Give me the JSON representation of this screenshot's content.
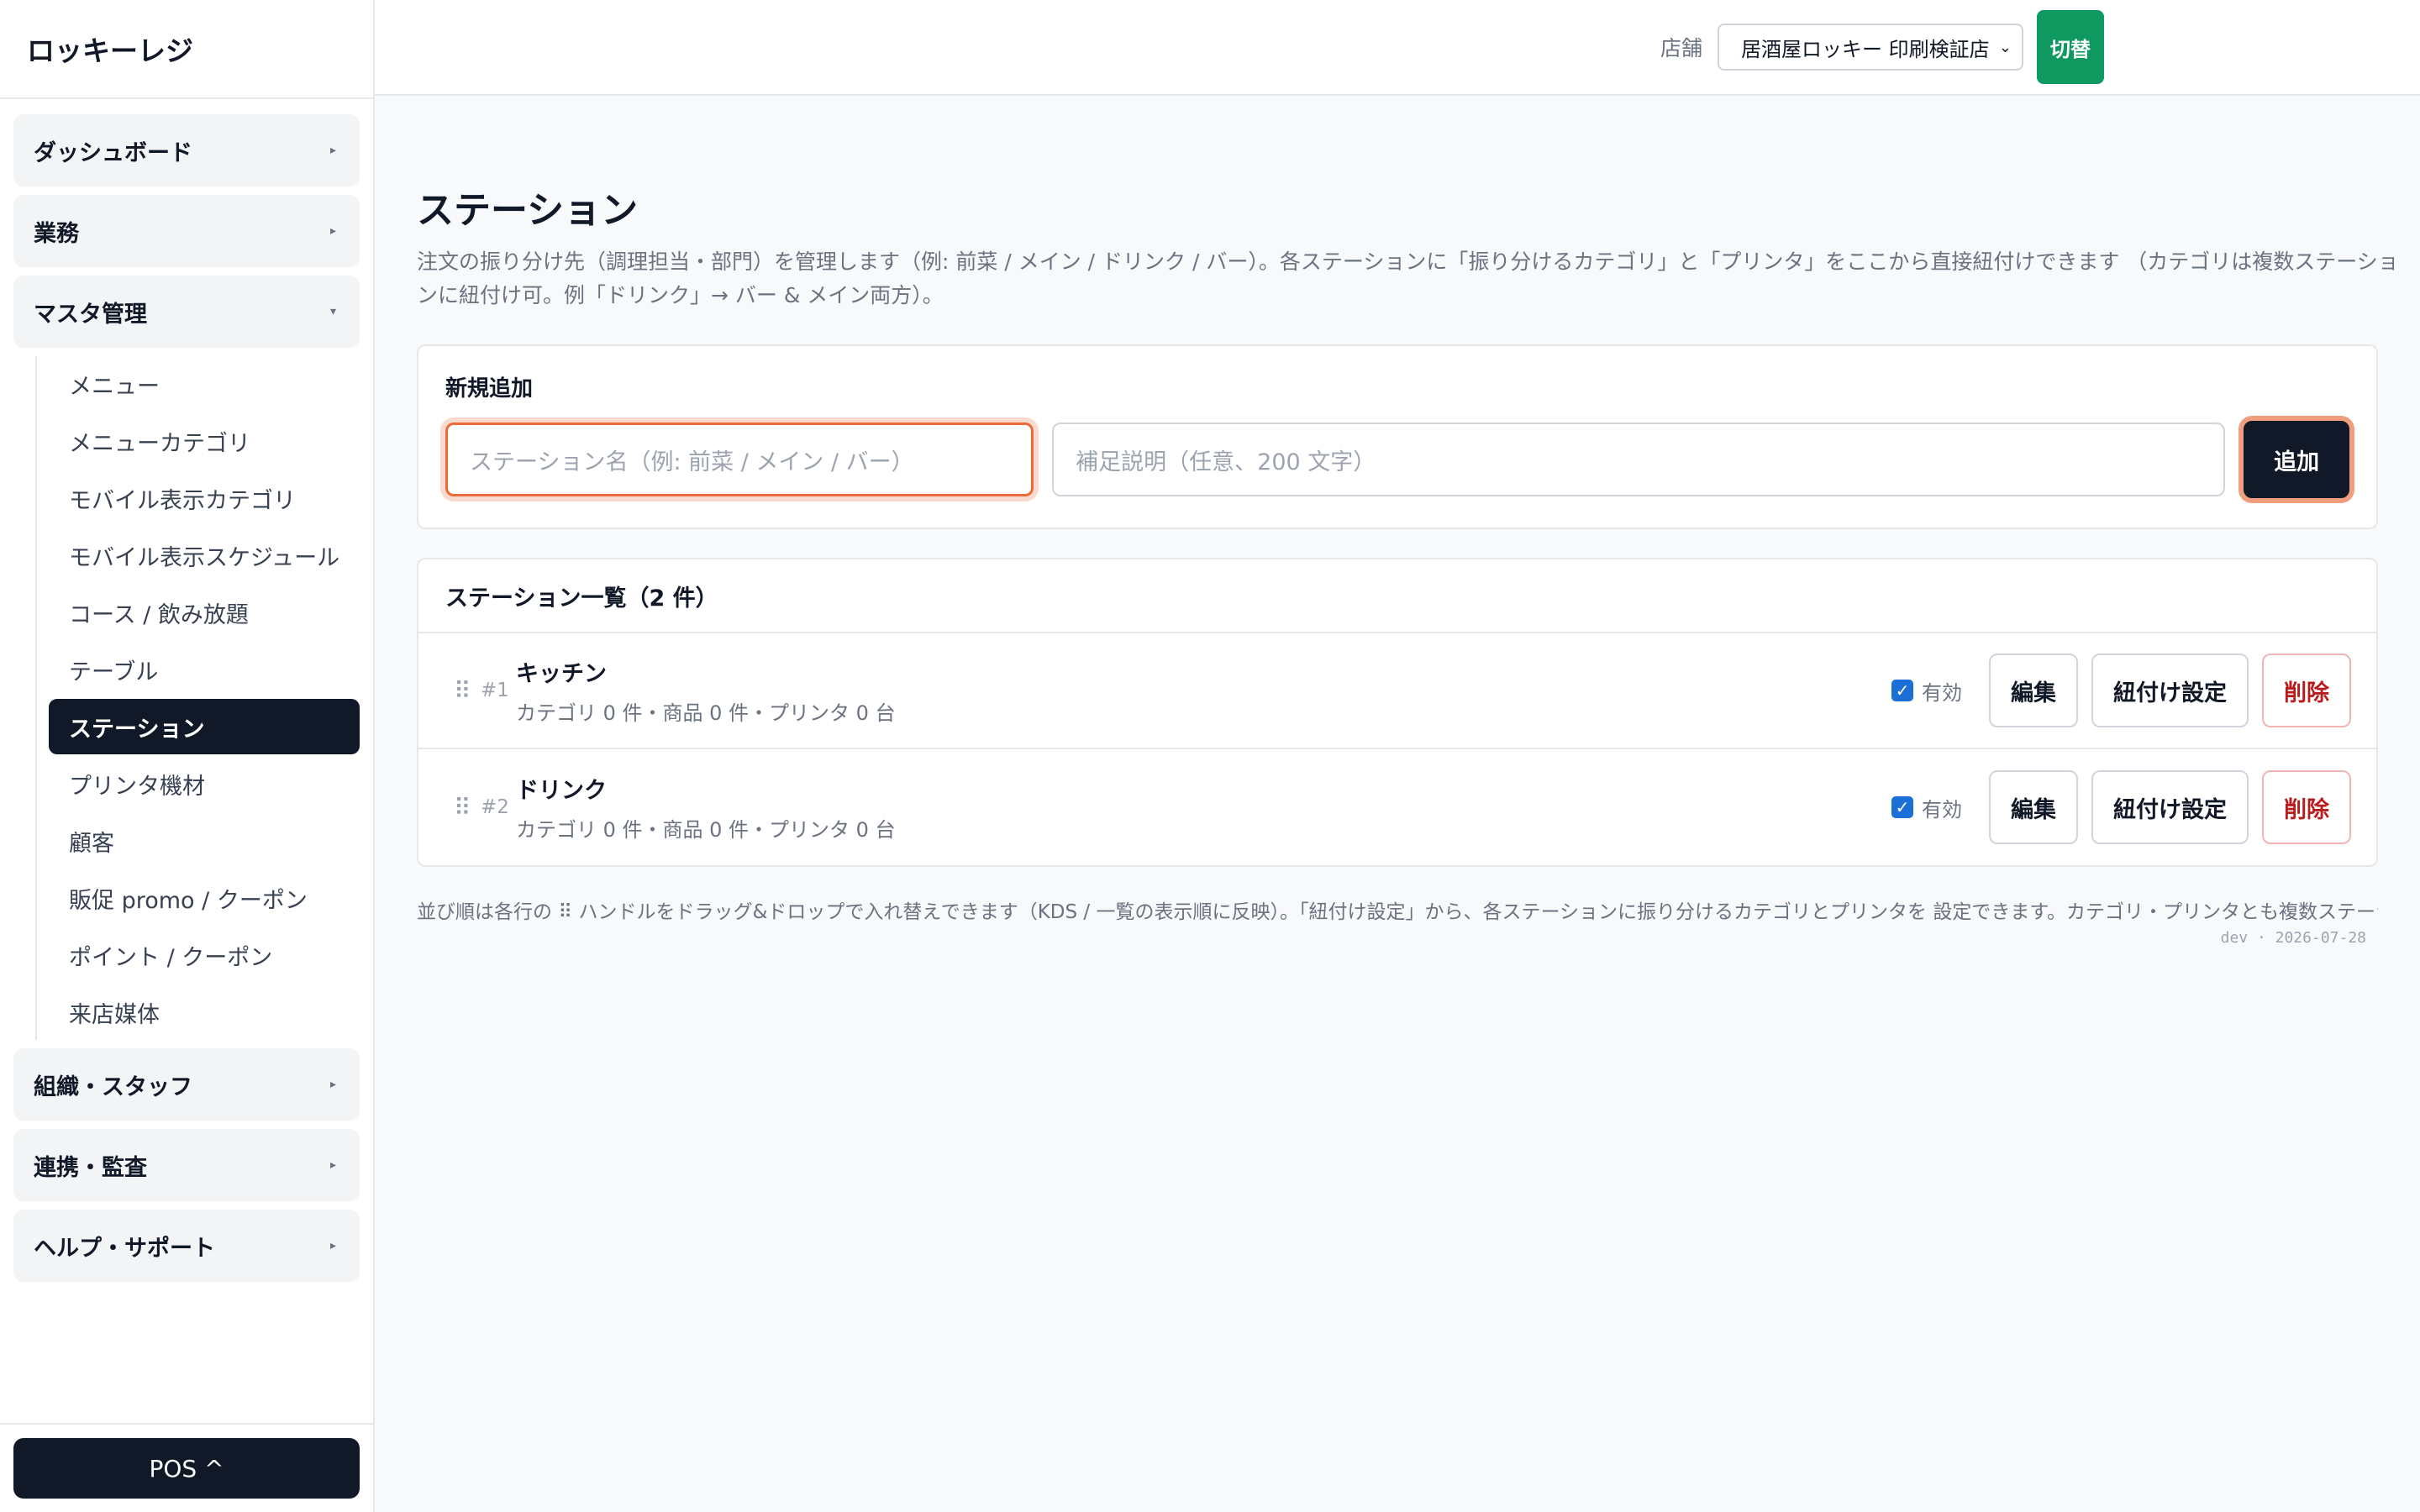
{
  "app": {
    "title": "ロッキーレジ"
  },
  "sidebar": {
    "groups": [
      {
        "label": "ダッシュボード",
        "caret": "▸"
      },
      {
        "label": "業務",
        "caret": "▸"
      },
      {
        "label": "マスタ管理",
        "caret": "▾"
      },
      {
        "label": "組織・スタッフ",
        "caret": "▸"
      },
      {
        "label": "連携・監査",
        "caret": "▸"
      },
      {
        "label": "ヘルプ・サポート",
        "caret": "▸"
      }
    ],
    "master_items": [
      "メニュー",
      "メニューカテゴリ",
      "モバイル表示カテゴリ",
      "モバイル表示スケジュール",
      "コース / 飲み放題",
      "テーブル",
      "ステーション",
      "プリンタ機材",
      "顧客",
      "販促 promo / クーポン",
      "ポイント / クーポン",
      "来店媒体"
    ],
    "active_item": "ステーション",
    "pos_button": "POS ^"
  },
  "topbar": {
    "store_label": "店舗",
    "store_selected": "居酒屋ロッキー 印刷検証店",
    "switch_label": "切替"
  },
  "page": {
    "title": "ステーション",
    "description": "注文の振り分け先（調理担当・部門）を管理します（例: 前菜 / メイン / ドリンク / バー）。各ステーションに「振り分けるカテゴリ」と「プリンタ」をここから直接紐付けできます （カテゴリは複数ステーションに紐付け可。例「ドリンク」→ バー & メイン両方）。"
  },
  "new_form": {
    "label": "新規追加",
    "name_placeholder": "ステーション名（例: 前菜 / メイン / バー）",
    "desc_placeholder": "補足説明（任意、200 文字）",
    "add_label": "追加"
  },
  "list": {
    "header": "ステーション一覧（2 件）",
    "enabled_label": "有効",
    "edit_label": "編集",
    "link_label": "紐付け設定",
    "delete_label": "削除",
    "rows": [
      {
        "num": "#1",
        "name": "キッチン",
        "meta": "カテゴリ 0 件・商品 0 件・プリンタ 0 台",
        "enabled": true
      },
      {
        "num": "#2",
        "name": "ドリンク",
        "meta": "カテゴリ 0 件・商品 0 件・プリンタ 0 台",
        "enabled": true
      }
    ]
  },
  "footnote": "並び順は各行の ⠿ ハンドルをドラッグ&ドロップで入れ替えできます（KDS / 一覧の表示順に反映）。「紐付け設定」から、各ステーションに振り分けるカテゴリとプリンタを 設定できます。カテゴリ・プリンタとも複数ステーションに紐付けられます（M:N）。",
  "build_info": "dev · 2026-07-28",
  "colors": {
    "primary": "#111827",
    "accent_green": "#0f9960",
    "focus_orange": "#ea6a3a",
    "danger": "#b91c1c",
    "check_blue": "#1d6fd8"
  }
}
